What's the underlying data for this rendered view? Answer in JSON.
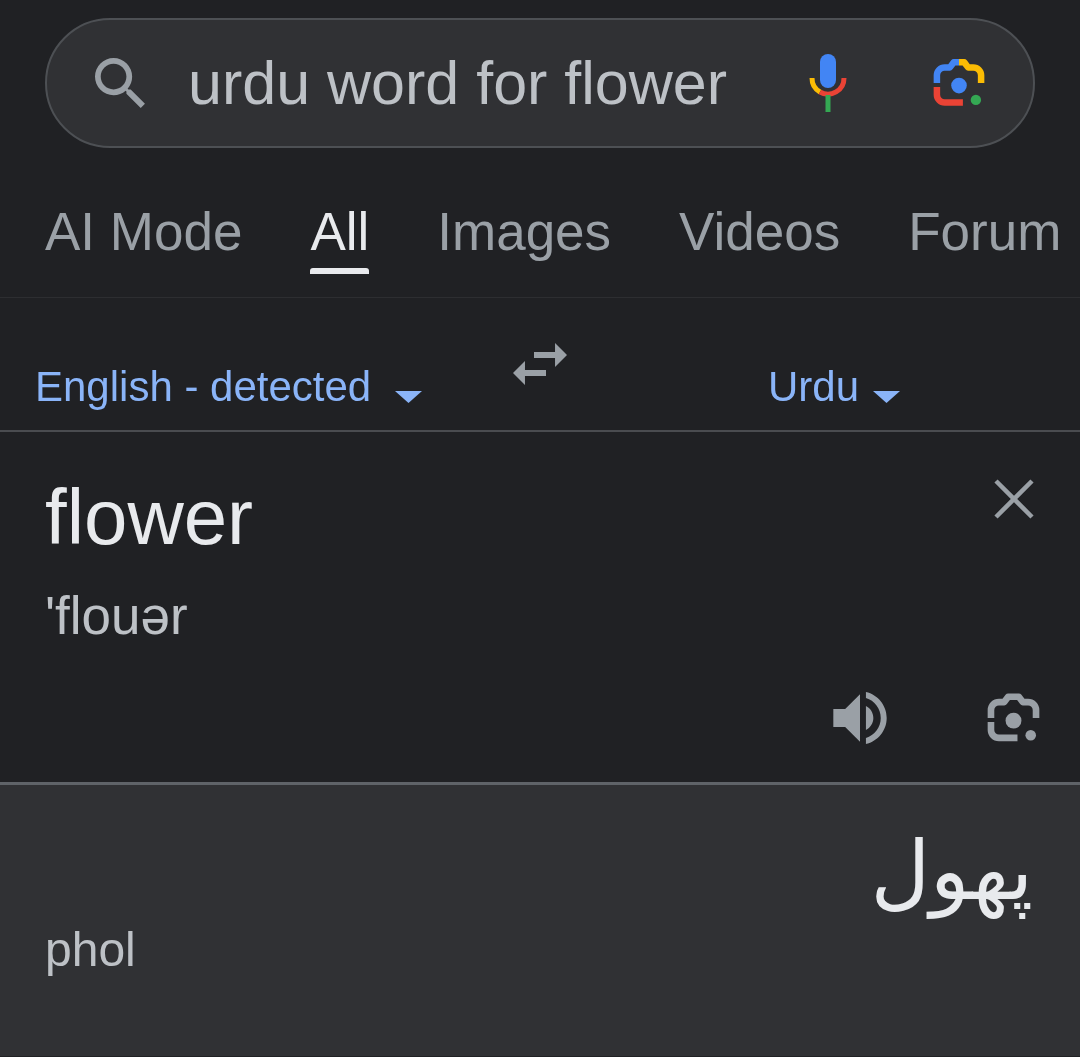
{
  "search": {
    "query": "urdu word for flower"
  },
  "tabs": [
    {
      "label": "AI Mode",
      "selected": false
    },
    {
      "label": "All",
      "selected": true
    },
    {
      "label": "Images",
      "selected": false
    },
    {
      "label": "Videos",
      "selected": false
    },
    {
      "label": "Forum",
      "selected": false
    }
  ],
  "translator": {
    "source_language": "English - detected",
    "target_language": "Urdu",
    "input": {
      "text": "flower",
      "pronunciation": "'flouər"
    },
    "output": {
      "text": "پھول",
      "transliteration": "phol"
    }
  }
}
